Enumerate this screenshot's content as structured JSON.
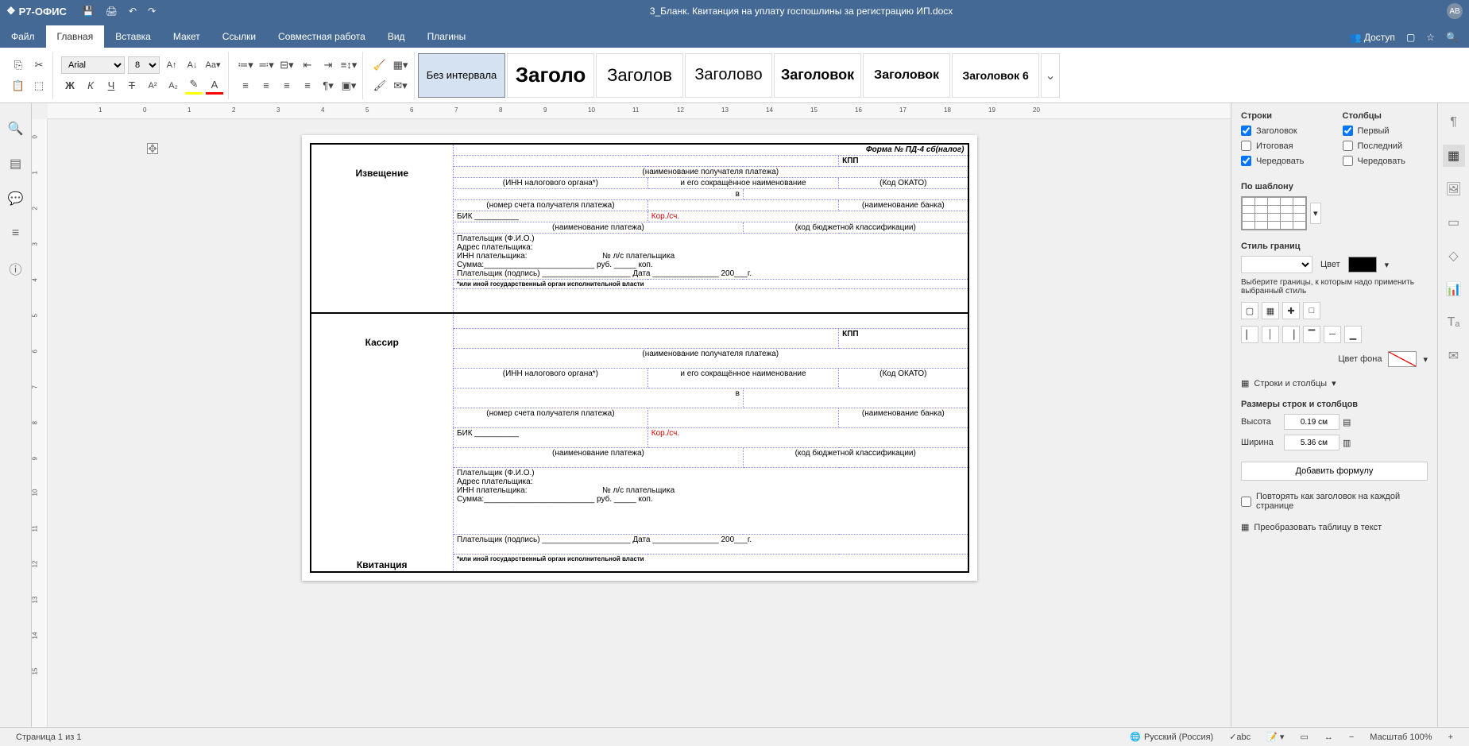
{
  "app": {
    "name": "Р7-ОФИС",
    "avatar": "AB"
  },
  "doc": {
    "title": "3_Бланк. Квитанция на уплату госпошлины за регистрацию ИП.docx"
  },
  "menubar": {
    "file": "Файл",
    "home": "Главная",
    "insert": "Вставка",
    "layout": "Макет",
    "references": "Ссылки",
    "collab": "Совместная работа",
    "view": "Вид",
    "plugins": "Плагины",
    "share": "Доступ"
  },
  "toolbar": {
    "font": "Arial",
    "size": "8",
    "bold": "Ж",
    "italic": "К",
    "underline": "Ч",
    "strike": "Т"
  },
  "styles": {
    "nospacing": "Без интервала",
    "h1": "Заголо",
    "h2": "Заголов",
    "h3": "Заголово",
    "h4": "Заголовок",
    "h5": "Заголовок",
    "h6": "Заголовок 6"
  },
  "document": {
    "form_title": "Форма № ПД-4 сб(налог)",
    "notification": "Извещение",
    "cashier": "Кассир",
    "receipt": "Квитанция",
    "kpp": "КПП",
    "recipient_name": "(наименование получателя платежа)",
    "inn_tax": "(ИНН налогового органа*)",
    "abbrev": "и его сокращённое наименование",
    "okato": "(Код ОКАТО)",
    "in": "в",
    "account": "(номер счета получателя платежа)",
    "bank_name": "(наименование банка)",
    "bik": "БИК",
    "kor": "Кор./сч.",
    "payment_name": "(наименование платежа)",
    "kbk": "(код бюджетной классификации)",
    "payer_fio": "Плательщик (Ф.И.О.)",
    "payer_addr": "Адрес плательщика:",
    "payer_inn": "ИНН плательщика:",
    "payer_ls": "№ л/с плательщика",
    "sum": "Сумма:_________________________ руб. _____ коп.",
    "payer_sign": "Плательщик (подпись) ____________________ Дата _______________ 200___г.",
    "footnote": "*или иной государственный орган исполнительной власти"
  },
  "rightpanel": {
    "rows": "Строки",
    "cols": "Столбцы",
    "header": "Заголовок",
    "total": "Итоговая",
    "first": "Первый",
    "last": "Последний",
    "banded": "Чередовать",
    "template": "По шаблону",
    "border_style": "Стиль границ",
    "color": "Цвет",
    "border_hint": "Выберите границы, к которым надо применить выбранный стиль",
    "bg_color": "Цвет фона",
    "rows_cols": "Строки и столбцы",
    "rc_sizes": "Размеры строк и столбцов",
    "height": "Высота",
    "width": "Ширина",
    "height_val": "0.19 см",
    "width_val": "5.36 см",
    "add_formula": "Добавить формулу",
    "repeat_header": "Повторять как заголовок на каждой странице",
    "convert": "Преобразовать таблицу в текст"
  },
  "statusbar": {
    "page": "Страница 1 из 1",
    "lang": "Русский (Россия)",
    "zoom": "Масштаб 100%"
  }
}
